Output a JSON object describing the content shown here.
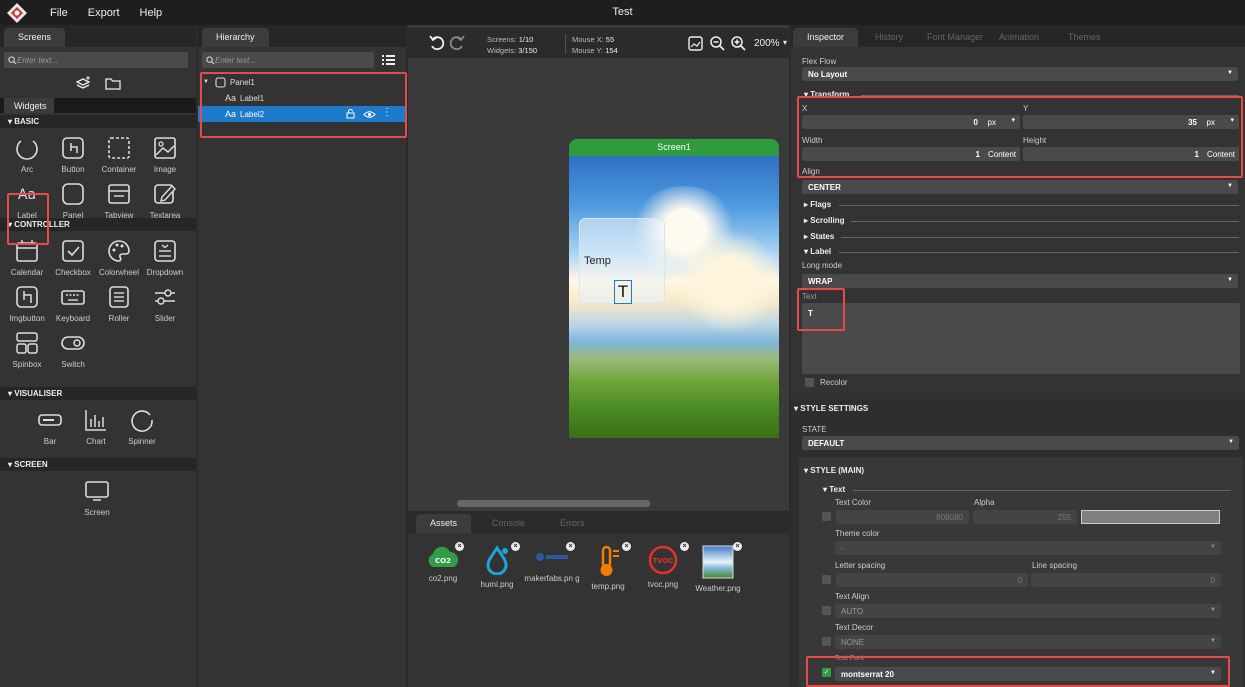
{
  "app": {
    "title": "Test",
    "menu": [
      "File",
      "Export",
      "Help"
    ]
  },
  "left": {
    "tab": "Screens",
    "search_placeholder": "Enter text...",
    "widgets_tab": "Widgets",
    "sections": {
      "basic": {
        "title": "BASIC",
        "items": [
          "Arc",
          "Button",
          "Container",
          "Image",
          "Label",
          "Panel",
          "Tabview",
          "Textarea"
        ]
      },
      "controller": {
        "title": "CONTROLLER",
        "items": [
          "Calendar",
          "Checkbox",
          "Colorwheel",
          "Dropdown",
          "Imgbutton",
          "Keyboard",
          "Roller",
          "Slider",
          "Spinbox",
          "Switch"
        ]
      },
      "visualiser": {
        "title": "VISUALISER",
        "items": [
          "Bar",
          "Chart",
          "Spinner"
        ]
      },
      "screen": {
        "title": "SCREEN",
        "items": [
          "Screen"
        ]
      }
    }
  },
  "hierarchy": {
    "tab": "Hierarchy",
    "search_placeholder": "Enter text...",
    "nodes": [
      {
        "label": "Panel1"
      },
      {
        "label": "Label1"
      },
      {
        "label": "Label2"
      }
    ]
  },
  "canvas": {
    "screens_label": "Screens:",
    "screens_value": "1/10",
    "widgets_label": "Widgets:",
    "widgets_value": "3/150",
    "mousex_label": "Mouse X:",
    "mousex_value": "55",
    "mousey_label": "Mouse Y:",
    "mousey_value": "154",
    "zoom": "200%",
    "screen_title": "Screen1",
    "panel_text": "Temp",
    "label2_text": "T"
  },
  "bottom": {
    "tabs": [
      "Assets",
      "Console",
      "Errors"
    ],
    "assets": [
      {
        "name": "co2.png",
        "icon": "co2-cloud-icon"
      },
      {
        "name": "humi.png",
        "icon": "water-drop-icon"
      },
      {
        "name": "makerfabs.pn g",
        "icon": "makerfabs-logo-icon"
      },
      {
        "name": "temp.png",
        "icon": "thermometer-icon"
      },
      {
        "name": "tvoc.png",
        "icon": "tvoc-icon"
      },
      {
        "name": "Weather.png",
        "icon": "weather-image-icon"
      }
    ]
  },
  "inspector": {
    "tabs": [
      "Inspector",
      "History",
      "Font Manager",
      "Animation",
      "Themes"
    ],
    "flex_flow_label": "Flex Flow",
    "flex_flow_value": "No Layout",
    "transform_title": "Transform",
    "x_label": "X",
    "x_value": "0",
    "x_unit": "px",
    "y_label": "Y",
    "y_value": "35",
    "y_unit": "px",
    "width_label": "Width",
    "width_value": "1",
    "width_unit": "Content",
    "height_label": "Height",
    "height_value": "1",
    "height_unit": "Content",
    "align_label": "Align",
    "align_value": "CENTER",
    "flags": "Flags",
    "scrolling": "Scrolling",
    "states": "States",
    "label_section": "Label",
    "long_mode_label": "Long mode",
    "long_mode_value": "WRAP",
    "text_label": "Text",
    "text_value": "T",
    "recolor_label": "Recolor",
    "style_settings": "STYLE SETTINGS",
    "state_label": "STATE",
    "state_value": "DEFAULT",
    "style_main": "STYLE (MAIN)",
    "text_group": "Text",
    "text_color_label": "Text Color",
    "text_color_value": "808080",
    "alpha_label": "Alpha",
    "alpha_value": "255",
    "theme_color_label": "Theme color",
    "theme_color_value": "-",
    "letter_spacing_label": "Letter spacing",
    "letter_spacing_value": "0",
    "line_spacing_label": "Line spacing",
    "line_spacing_value": "0",
    "text_align_label": "Text Align",
    "text_align_value": "AUTO",
    "text_decor_label": "Text Decor",
    "text_decor_value": "NONE",
    "text_font_label": "Text Font",
    "text_font_value": "montserrat 20"
  },
  "colors": {
    "accent_blue": "#1e7acb",
    "screen_green": "#2e9b3c",
    "highlight_red": "#e84a4a"
  }
}
